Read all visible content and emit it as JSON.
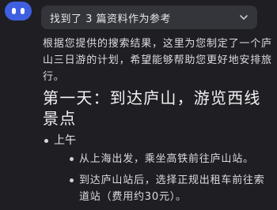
{
  "colors": {
    "background": "#1e1e23",
    "avatar": "#3f5fe0",
    "reference_bar": "#34353b",
    "text": "#dcdce0"
  },
  "assistant_avatar": {
    "icon": "assistant-logo-icon"
  },
  "references": {
    "label": "找到了 3 篇资料作为参考",
    "icon": "chevron-down-icon"
  },
  "answer": {
    "intro": "根据您提供的搜索结果，这里为您制定了一个庐山三日游的计划，希望能够帮助您更好地安排旅行。",
    "day1": {
      "title": "第一天：到达庐山，游览西线景点",
      "sections": [
        {
          "label": "上午",
          "items": [
            "从上海出发，乘坐高铁前往庐山站。",
            "到达庐山站后，选择正规出租车前往索道站（费用约30元）。"
          ]
        }
      ]
    }
  }
}
